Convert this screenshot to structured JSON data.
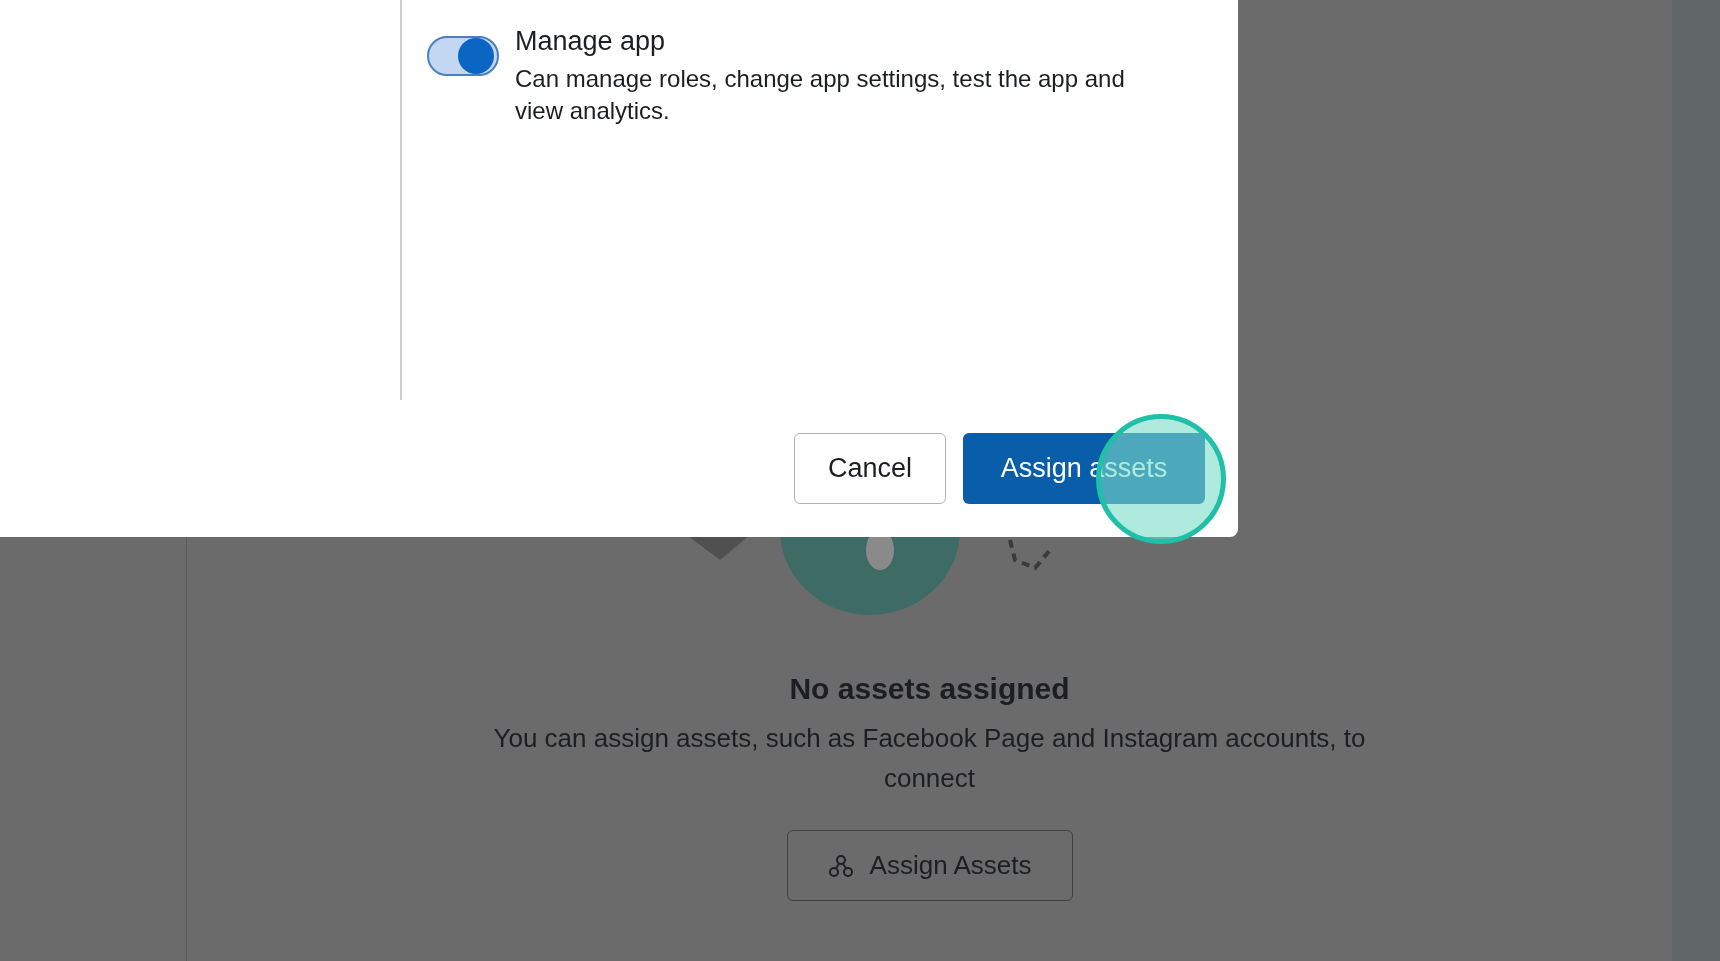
{
  "dialog": {
    "permission": {
      "title": "Manage app",
      "description": "Can manage roles, change app settings, test the app and view analytics.",
      "on": true
    },
    "buttons": [
      {
        "label": "Cancel",
        "kind": "secondary"
      },
      {
        "label": "Assign assets",
        "kind": "primary"
      }
    ]
  },
  "empty_state": {
    "title": "No assets assigned",
    "description": "You can assign assets, such as Facebook Page and Instagram accounts, to connect",
    "button": "Assign Assets"
  }
}
